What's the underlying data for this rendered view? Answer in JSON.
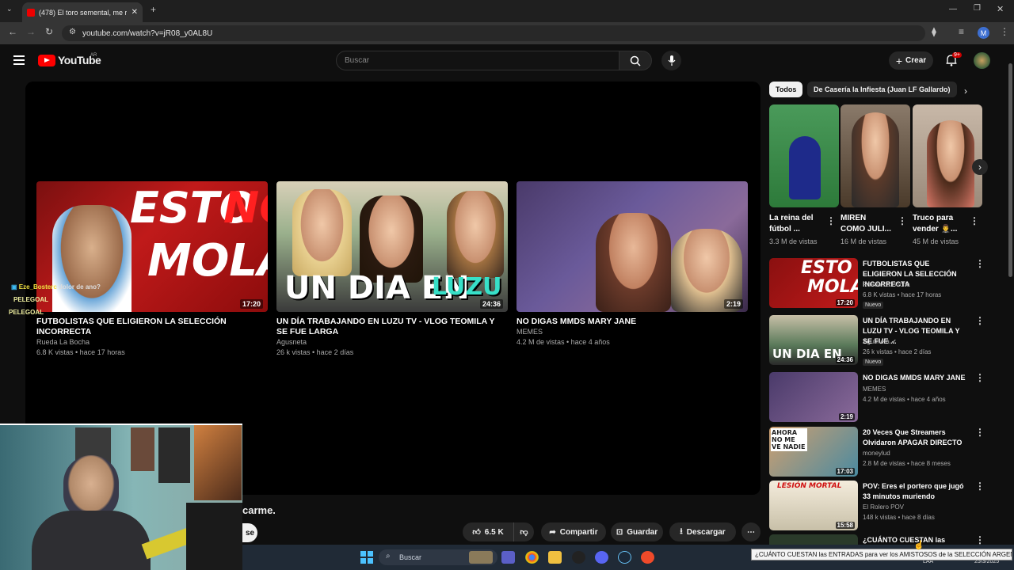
{
  "browser": {
    "tab_title": "(478) El toro semental, me reta",
    "url": "youtube.com/watch?v=jR08_y0AL8U",
    "profile_initial": "M"
  },
  "header": {
    "logo_text": "YouTube",
    "region": "AR",
    "search_placeholder": "Buscar",
    "create_label": "Crear",
    "notif_count": "9+"
  },
  "endscreen": [
    {
      "title": "FUTBOLISTAS QUE ELIGIERON LA SELECCIÓN INCORRECTA",
      "channel": "Rueda La Bocha",
      "meta": "6.8 K vistas • hace 17 horas",
      "duration": "17:20",
      "thumb_text_1": "ESTO",
      "thumb_text_2": "NO",
      "thumb_text_3": "MOLA"
    },
    {
      "title": "UN DÍA TRABAJANDO EN LUZU TV - VLOG TEOMILA Y SE FUE LARGA",
      "channel": "Agusneta",
      "meta": "26 k vistas • hace 2 días",
      "duration": "24:36",
      "thumb_text_1": "UN DIA EN",
      "thumb_text_2": "LUZU"
    },
    {
      "title": "NO DIGAS MMDS MARY JANE",
      "channel": "MEMES",
      "meta": "4.2 M de vistas • hace 4 años",
      "duration": "2:19"
    }
  ],
  "overlay_chat": {
    "user": "Eze_Bosterc",
    "message": "dolor de ano?",
    "line2": "PELEGOAL",
    "line3": "PELEGOAL"
  },
  "description_fragment": "carme.",
  "actions": {
    "likes": "6.5 K",
    "share": "Compartir",
    "save": "Guardar",
    "download": "Descargar",
    "partial_btn": "se"
  },
  "chips": [
    "Todos",
    "De Casería la Infiesta (Juan LF Gallardo)"
  ],
  "shorts": [
    {
      "title": "La reina del fútbol ...",
      "views": "3.3 M de vistas",
      "color": "#2d7a3a"
    },
    {
      "title": "MIREN COMO JULI...",
      "views": "16 M de vistas",
      "color": "#7a5a4a"
    },
    {
      "title": "Truco para vender 🤵‍♂️...",
      "views": "45 M de vistas",
      "color": "#b69a8a"
    }
  ],
  "related": [
    {
      "title": "FUTBOLISTAS QUE ELIGIERON LA SELECCIÓN INCORRECTA",
      "channel": "Rueda La Bocha",
      "views": "6.8 K vistas • hace 17 horas",
      "duration": "17:20",
      "badge": "Nuevo",
      "color": "#b71c1c"
    },
    {
      "title": "UN DÍA TRABAJANDO EN LUZU TV - VLOG TEOMILA Y SE FUE ...",
      "channel": "Agusneta ✔",
      "views": "26 k vistas • hace 2 días",
      "duration": "24:36",
      "badge": "Nuevo",
      "color": "#5b7a5b"
    },
    {
      "title": "NO DIGAS MMDS MARY JANE",
      "channel": "MEMES",
      "views": "4.2 M de vistas • hace 4 años",
      "duration": "2:19",
      "badge": "",
      "color": "#6a5a8a"
    },
    {
      "title": "20 Veces Que Streamers Olvidaron APAGAR DIRECTO",
      "channel": "moneylud",
      "views": "2.8 M de vistas • hace 8 meses",
      "duration": "17:03",
      "badge": "",
      "color": "#c08a5a",
      "thumb_text": "AHORA NO ME VE NADIE"
    },
    {
      "title": "POV: Eres el portero que jugó 33 minutos muriendo",
      "channel": "El Rolero POV",
      "views": "148 k vistas • hace 8 días",
      "duration": "15:58",
      "badge": "",
      "color": "#e8e0d0",
      "thumb_text": "LESIÓN MORTAL"
    },
    {
      "title": "¿CUÁNTO CUESTAN las",
      "channel": "",
      "views": "",
      "duration": "",
      "badge": "",
      "color": "#333"
    }
  ],
  "taskbar": {
    "search_placeholder": "Buscar",
    "tooltip": "¿CUÁNTO CUESTAN las ENTRADAS para ver los AMISTOSOS de la SELECCIÓN ARGENTINA?",
    "lang": "ESP\nLAA",
    "date": "25/3/2025"
  }
}
